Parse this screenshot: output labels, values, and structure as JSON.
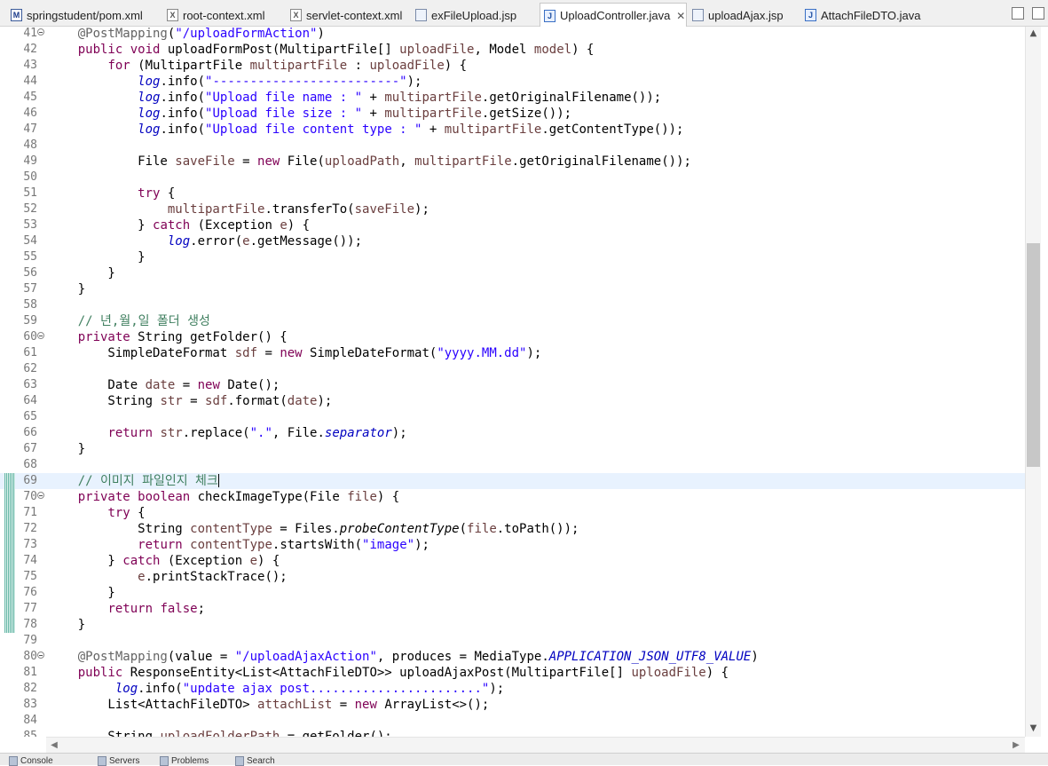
{
  "tabs": [
    {
      "label": "springstudent/pom.xml",
      "icon": "maven-pom-icon",
      "active": false
    },
    {
      "label": "root-context.xml",
      "icon": "xml-file-icon",
      "active": false
    },
    {
      "label": "servlet-context.xml",
      "icon": "xml-file-icon",
      "active": false
    },
    {
      "label": "exFileUpload.jsp",
      "icon": "jsp-file-icon",
      "active": false
    },
    {
      "label": "UploadController.java",
      "icon": "java-file-icon",
      "active": true
    },
    {
      "label": "uploadAjax.jsp",
      "icon": "jsp-file-icon",
      "active": false
    },
    {
      "label": "AttachFileDTO.java",
      "icon": "java-file-icon",
      "active": false
    }
  ],
  "editor": {
    "first_line": 41,
    "current_line": 69,
    "changed_lines": [
      69,
      70,
      71,
      72,
      73,
      74,
      75,
      76,
      77,
      78
    ],
    "folded_lines": [
      41,
      60,
      70,
      80
    ],
    "lines": [
      "    @PostMapping(\"/uploadFormAction\")",
      "    public void uploadFormPost(MultipartFile[] uploadFile, Model model) {",
      "        for (MultipartFile multipartFile : uploadFile) {",
      "            log.info(\"-------------------------\");",
      "            log.info(\"Upload file name : \" + multipartFile.getOriginalFilename());",
      "            log.info(\"Upload file size : \" + multipartFile.getSize());",
      "            log.info(\"Upload file content type : \" + multipartFile.getContentType());",
      "",
      "            File saveFile = new File(uploadPath, multipartFile.getOriginalFilename());",
      "",
      "            try {",
      "                multipartFile.transferTo(saveFile);",
      "            } catch (Exception e) {",
      "                log.error(e.getMessage());",
      "            }",
      "        }",
      "    }",
      "",
      "    // 년,월,일 폴더 생성",
      "    private String getFolder() {",
      "        SimpleDateFormat sdf = new SimpleDateFormat(\"yyyy.MM.dd\");",
      "",
      "        Date date = new Date();",
      "        String str = sdf.format(date);",
      "",
      "        return str.replace(\".\", File.separator);",
      "    }",
      "",
      "    // 이미지 파일인지 체크",
      "    private boolean checkImageType(File file) {",
      "        try {",
      "            String contentType = Files.probeContentType(file.toPath());",
      "            return contentType.startsWith(\"image\");",
      "        } catch (Exception e) {",
      "            e.printStackTrace();",
      "        }",
      "        return false;",
      "    }",
      "",
      "    @PostMapping(value = \"/uploadAjaxAction\", produces = MediaType.APPLICATION_JSON_UTF8_VALUE)",
      "    public ResponseEntity<List<AttachFileDTO>> uploadAjaxPost(MultipartFile[] uploadFile) {",
      "         log.info(\"update ajax post.......................\");",
      "        List<AttachFileDTO> attachList = new ArrayList<>();",
      "",
      "        String uploadFolderPath = getFolder();"
    ]
  },
  "bottom_panel": {
    "tabs": [
      "Console",
      "Servers",
      "Problems",
      "Search"
    ]
  }
}
